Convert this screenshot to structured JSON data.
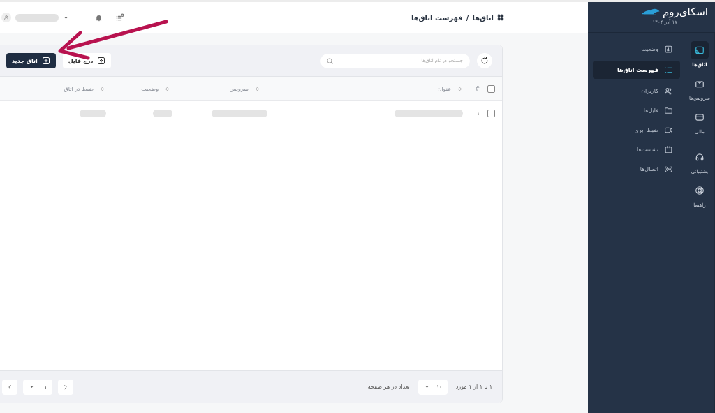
{
  "sidebar": {
    "logo": "اسکای‌روم",
    "date": "۱۷ آذر ۱۴۰۴",
    "rail": [
      {
        "label": "اتاق‌ها",
        "selected": true
      },
      {
        "label": "سرویس‌ها",
        "selected": false
      },
      {
        "label": "مالی",
        "selected": false
      },
      {
        "label": "پشتیبانی",
        "selected": false
      },
      {
        "label": "راهنما",
        "selected": false
      }
    ],
    "menu": [
      {
        "label": "وضعیت",
        "selected": false
      },
      {
        "label": "فهرست اتاق‌ها",
        "selected": true
      },
      {
        "label": "کاربران",
        "selected": false
      },
      {
        "label": "فایل‌ها",
        "selected": false
      },
      {
        "label": "ضبط ابری",
        "selected": false
      },
      {
        "label": "نشست‌ها",
        "selected": false
      },
      {
        "label": "اتصال‌ها",
        "selected": false
      }
    ]
  },
  "header": {
    "breadcrumb": [
      "اتاق‌ها",
      "/",
      "فهرست اتاق‌ها"
    ]
  },
  "toolbar": {
    "search_placeholder": "جستجو در نام اتاق‌ها",
    "upload_button": "درج فایل",
    "new_button": "اتاق جدید"
  },
  "table": {
    "select_all_checked": false,
    "columns": [
      "#",
      "عنوان",
      "سرویس",
      "وضعیت",
      "ضبط در اتاق"
    ],
    "rows": [
      {
        "checked": false,
        "number": "۱"
      }
    ]
  },
  "footer": {
    "range": "۱ تا ۱ از ۱ مورد",
    "per_page_label": "تعداد در هر صفحه",
    "per_page": "۱۰",
    "page": "۱"
  }
}
